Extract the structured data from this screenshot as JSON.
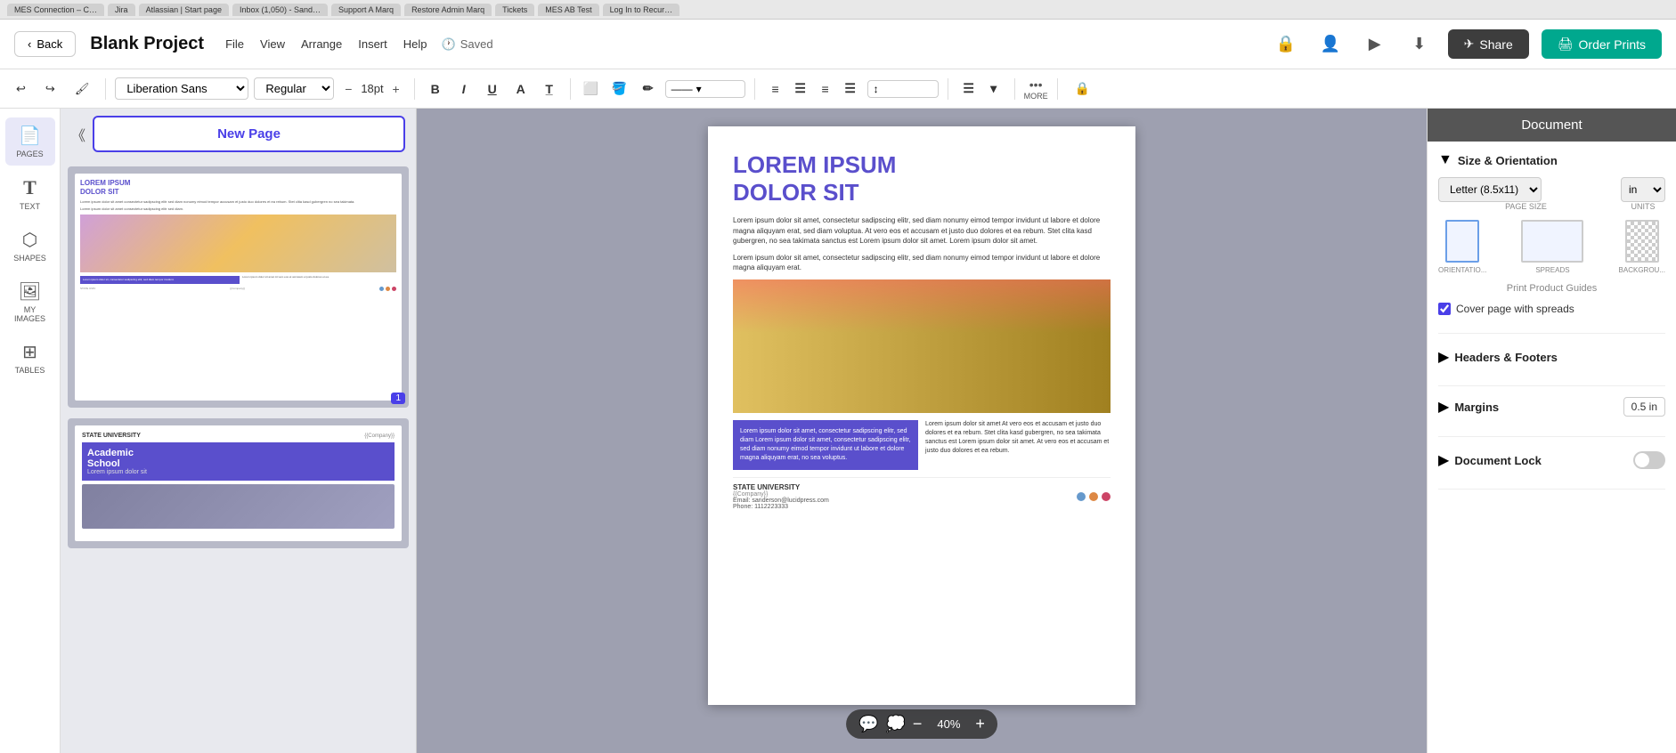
{
  "browser_tabs": {
    "items": [
      {
        "label": "MES Connection – C…"
      },
      {
        "label": "Jira"
      },
      {
        "label": "Atlassian | Start page"
      },
      {
        "label": "Inbox (1,050) - Sand…"
      },
      {
        "label": "Support A Marq"
      },
      {
        "label": "Restore Admin Marq"
      },
      {
        "label": "Tickets"
      },
      {
        "label": "MES AB Test"
      },
      {
        "label": "Log In to Recur…"
      }
    ]
  },
  "header": {
    "back_label": "Back",
    "project_title": "Blank Project",
    "menu": {
      "file": "File",
      "view": "View",
      "arrange": "Arrange",
      "insert": "Insert",
      "help": "Help"
    },
    "saved_status": "Saved",
    "share_label": "Share",
    "order_label": "Order Prints"
  },
  "toolbar": {
    "font_name": "Liberation Sans",
    "font_style": "Regular",
    "font_size": "18pt",
    "bold": "B",
    "italic": "I",
    "underline": "U",
    "text_format": "A",
    "more_label": "MORE"
  },
  "left_sidebar": {
    "items": [
      {
        "id": "pages",
        "label": "PAGES",
        "icon": "📄"
      },
      {
        "id": "text",
        "label": "TEXT",
        "icon": "T"
      },
      {
        "id": "shapes",
        "label": "SHAPES",
        "icon": "⬡"
      },
      {
        "id": "my-images",
        "label": "MY IMAGES",
        "icon": "🖼"
      },
      {
        "id": "tables",
        "label": "TABLES",
        "icon": "⊞"
      }
    ]
  },
  "pages_panel": {
    "new_page_label": "New Page",
    "page1_number": "1"
  },
  "document_canvas": {
    "title_line1": "LOREM IPSUM",
    "title_line2": "DOLOR SIT",
    "body_text1": "Lorem ipsum dolor sit amet, consectetur sadipscing elitr, sed diam nonumy eimod tempor invidunt ut labore et dolore magna aliquyam erat, sed diam voluptua. At vero eos et accusam et justo duo dolores et ea rebum. Stet clita kasd gubergren, no sea takimata sanctus est Lorem ipsum dolor sit amet. Lorem ipsum dolor sit amet.",
    "body_text2": "Lorem ipsum dolor sit amet, consectetur sadipscing elitr, sed diam nonumy eimod tempor invidunt ut labore et dolore magna aliquyam erat.",
    "purple_box_text": "Lorem ipsum dolor sit amet, consectetur sadipscing elitr, sed diam Lorem ipsum dolor sit amet, consectetur sadipscing elitr, sed diam nonumy eimod tempor invidunt ut labore et dolore magna aliquyam erat, no sea voluptus.",
    "right_text": "Lorem ipsum dolor sit amet At vero eos et accusam et justo duo dolores et ea rebum. Stet clita kasd gubergren, no sea takimata sanctus est Lorem ipsum dolor sit amet. At vero eos et accusam et justo duo dolores et ea rebum.",
    "footer_logo": "STATE UNIVERSITY",
    "footer_company": "{{Company}}",
    "footer_email_label": "Email:",
    "footer_email": "sanderson@lucidpress.com",
    "footer_phone_label": "Phone:",
    "footer_phone": "1112223333"
  },
  "page2_thumbnail": {
    "logo": "STATE UNIVERSITY",
    "company_tag": "{{Company}}",
    "headline1": "Academic",
    "headline2": "School",
    "subheadline": "Lorem ipsum dolor sit"
  },
  "right_panel": {
    "title": "Document",
    "size_orientation": {
      "section_label": "Size & Orientation",
      "page_size_label": "PAGE SIZE",
      "units_label": "UNITS",
      "page_size_value": "Letter (8.5x11)",
      "units_value": "in",
      "orientation_label": "ORIENTATIO...",
      "spreads_label": "SPREADS",
      "background_label": "BACKGROU...",
      "guides_label": "Print Product Guides",
      "cover_page_label": "Cover page with spreads"
    },
    "headers_footers": {
      "section_label": "Headers & Footers"
    },
    "margins": {
      "section_label": "Margins",
      "value": "0.5 in"
    },
    "document_lock": {
      "section_label": "Document Lock"
    }
  },
  "zoom_bar": {
    "zoom_value": "40%",
    "minus_label": "−",
    "plus_label": "+"
  }
}
